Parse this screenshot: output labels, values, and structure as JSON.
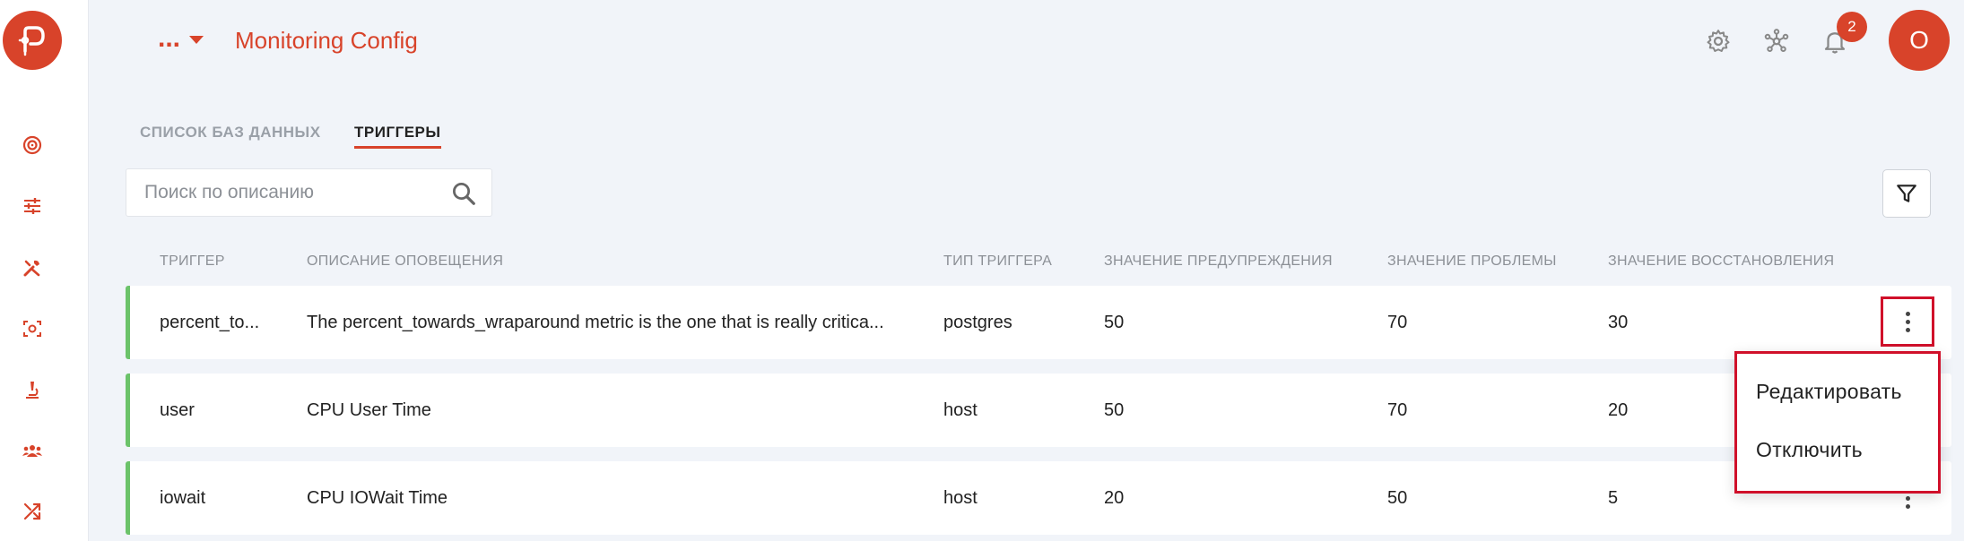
{
  "header": {
    "more_label": "...",
    "title": "Monitoring Config",
    "notifications_count": "2",
    "avatar_initial": "O"
  },
  "sidebar": {
    "items": [
      {
        "icon": "target-icon"
      },
      {
        "icon": "sliders-icon"
      },
      {
        "icon": "tools-icon"
      },
      {
        "icon": "scan-icon"
      },
      {
        "icon": "microscope-icon"
      },
      {
        "icon": "team-icon"
      },
      {
        "icon": "shuffle-icon"
      }
    ]
  },
  "tabs": [
    {
      "label": "СПИСОК БАЗ ДАННЫХ",
      "active": false
    },
    {
      "label": "ТРИГГЕРЫ",
      "active": true
    }
  ],
  "search": {
    "placeholder": "Поиск по описанию",
    "value": ""
  },
  "table": {
    "columns": [
      "ТРИГГЕР",
      "ОПИСАНИЕ ОПОВЕЩЕНИЯ",
      "ТИП ТРИГГЕРА",
      "ЗНАЧЕНИЕ ПРЕДУПРЕЖДЕНИЯ",
      "ЗНАЧЕНИЕ ПРОБЛЕМЫ",
      "ЗНАЧЕНИЕ ВОССТАНОВЛЕНИЯ"
    ],
    "rows": [
      {
        "trigger": "percent_to...",
        "description": "The percent_towards_wraparound metric is the one that is really critica...",
        "type": "postgres",
        "warning": "50",
        "problem": "70",
        "recovery": "30"
      },
      {
        "trigger": "user",
        "description": "CPU User Time",
        "type": "host",
        "warning": "50",
        "problem": "70",
        "recovery": "20"
      },
      {
        "trigger": "iowait",
        "description": "CPU IOWait Time",
        "type": "host",
        "warning": "20",
        "problem": "50",
        "recovery": "5"
      }
    ]
  },
  "row_menu": {
    "items": [
      "Редактировать",
      "Отключить"
    ]
  },
  "colors": {
    "accent": "#d8432a",
    "status_green": "#6cc36a",
    "highlight_red": "#d0102a"
  }
}
